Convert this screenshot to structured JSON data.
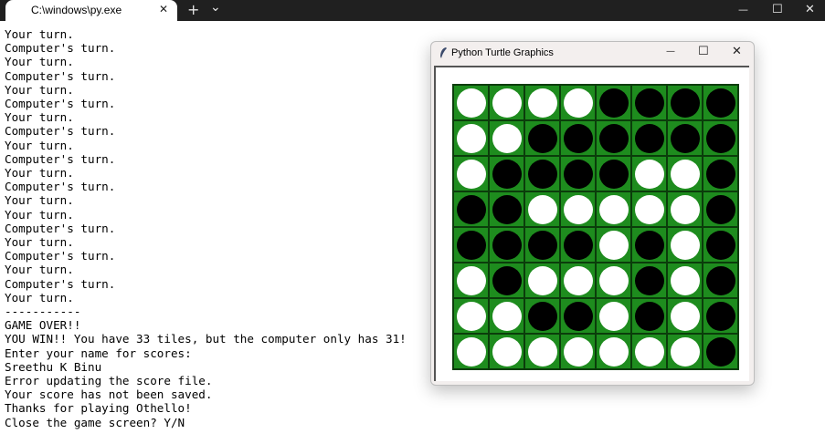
{
  "terminal_window": {
    "tab_title": "C:\\windows\\py.exe",
    "tab_close_glyph": "✕",
    "new_tab_glyph": "+",
    "dropdown_glyph": "⌄",
    "minimize_glyph": "—",
    "maximize_glyph": "☐",
    "close_glyph": "✕"
  },
  "console": {
    "lines": [
      "Your turn.",
      "Computer's turn.",
      "Your turn.",
      "Computer's turn.",
      "Your turn.",
      "Computer's turn.",
      "Your turn.",
      "Computer's turn.",
      "Your turn.",
      "Computer's turn.",
      "Your turn.",
      "Computer's turn.",
      "Your turn.",
      "Your turn.",
      "Computer's turn.",
      "Your turn.",
      "Computer's turn.",
      "Your turn.",
      "Computer's turn.",
      "Your turn.",
      "-----------",
      "GAME OVER!!",
      "YOU WIN!! You have 33 tiles, but the computer only has 31!",
      "Enter your name for scores:",
      "Sreethu K Binu",
      "Error updating the score file.",
      "Your score has not been saved.",
      "Thanks for playing Othello!",
      "Close the game screen? Y/N"
    ]
  },
  "turtle_window": {
    "title": "Python Turtle Graphics",
    "minimize_glyph": "—",
    "maximize_glyph": "☐",
    "close_glyph": "✕"
  },
  "board": {
    "size": 8,
    "board_color": "#1e8c1e",
    "grid_color": "#0b3d0b",
    "white_color": "#ffffff",
    "black_color": "#000000",
    "rows": [
      [
        "W",
        "W",
        "W",
        "W",
        "B",
        "B",
        "B",
        "B"
      ],
      [
        "W",
        "W",
        "B",
        "B",
        "B",
        "B",
        "B",
        "B"
      ],
      [
        "W",
        "B",
        "B",
        "B",
        "B",
        "W",
        "W",
        "B"
      ],
      [
        "B",
        "B",
        "W",
        "W",
        "W",
        "W",
        "W",
        "B"
      ],
      [
        "B",
        "B",
        "B",
        "B",
        "W",
        "B",
        "W",
        "B"
      ],
      [
        "W",
        "B",
        "W",
        "W",
        "W",
        "B",
        "W",
        "B"
      ],
      [
        "W",
        "W",
        "B",
        "B",
        "W",
        "B",
        "W",
        "B"
      ],
      [
        "W",
        "W",
        "W",
        "W",
        "W",
        "W",
        "W",
        "B"
      ]
    ]
  }
}
